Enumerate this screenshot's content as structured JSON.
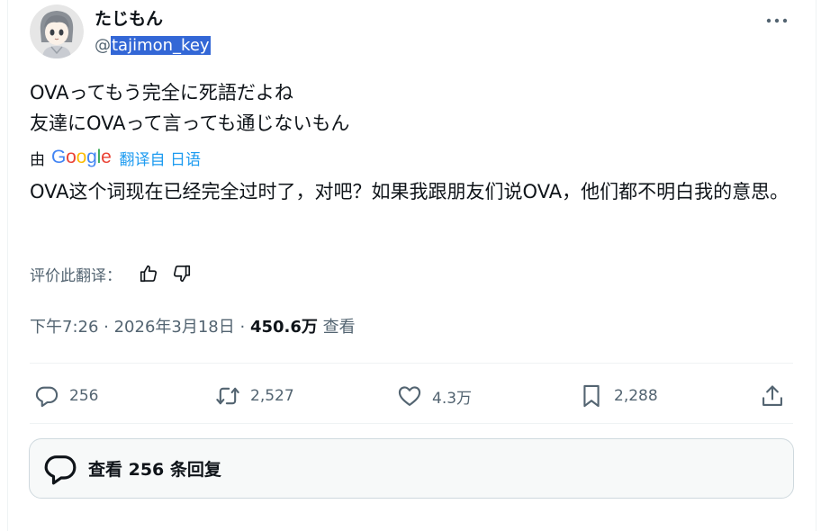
{
  "author": {
    "display_name": "たじもん",
    "handle_prefix": "@",
    "handle": "tajimon_key"
  },
  "tweet": {
    "lines": [
      "OVAってもう完全に死語だよね",
      "友達にOVAって言っても通じないもん"
    ]
  },
  "translation": {
    "by_label": "由",
    "provider": "Google",
    "link_label": "翻译自 日语",
    "text": "OVA这个词现在已经完全过时了，对吧？如果我跟朋友们说OVA，他们都不明白我的意思。",
    "rate_label": "评价此翻译："
  },
  "meta": {
    "time": "下午7:26",
    "separator": " · ",
    "date": "2026年3月18日",
    "views_count": "450.6万",
    "views_label": " 查看"
  },
  "actions": {
    "replies": "256",
    "reposts": "2,527",
    "likes": "4.3万",
    "bookmarks": "2,288"
  },
  "replies_button": {
    "label": "查看 256 条回复"
  },
  "icons": [
    "more-icon",
    "thumbs-up-icon",
    "thumbs-down-icon",
    "reply-icon",
    "repost-icon",
    "like-icon",
    "bookmark-icon",
    "share-icon",
    "comment-bubble-icon"
  ],
  "colors": {
    "text": "#0f1419",
    "secondary": "#536471",
    "link": "#1d9bf0",
    "selection": "#3367d6",
    "border": "#cfd9de",
    "google_blue": "#4285f4",
    "google_red": "#ea4335",
    "google_yellow": "#fbbc05",
    "google_green": "#34a853"
  }
}
